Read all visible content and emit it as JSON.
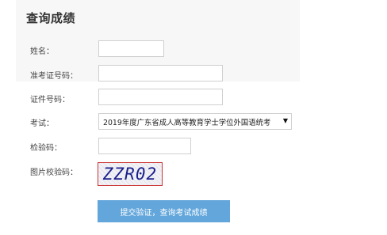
{
  "page": {
    "title": "查询成绩"
  },
  "form": {
    "name_label": "姓名：",
    "name_value": "",
    "ticket_label": "准考证号码：",
    "ticket_value": "",
    "id_label": "证件号码：",
    "id_value": "",
    "exam_label": "考试：",
    "exam_selected": "2019年度广东省成人高等教育学士学位外国语统考",
    "verify_label": "检验码：",
    "verify_value": "",
    "captcha_label": "图片校验码：",
    "captcha_text": "ZZR02",
    "submit_label": "提交验证，查询考试成绩"
  },
  "icons": {
    "dropdown": "triangle-down-icon"
  },
  "colors": {
    "button_bg": "#62a6db",
    "captcha_border": "#cc3333",
    "panel_bg": "#f7f7f7"
  }
}
